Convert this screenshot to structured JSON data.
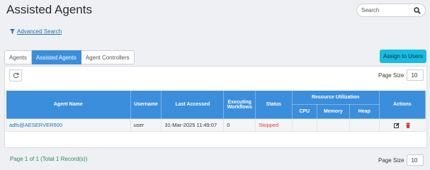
{
  "header": {
    "title": "Assisted Agents"
  },
  "search": {
    "placeholder": "Search",
    "value": ""
  },
  "advanced_search": {
    "label": "Advanced Search"
  },
  "tabs": [
    {
      "label": "Agents",
      "active": false
    },
    {
      "label": "Assisted Agents",
      "active": true
    },
    {
      "label": "Agent Controllers",
      "active": false
    }
  ],
  "toolbar": {
    "assign_label": "Assign to Users"
  },
  "page_size": {
    "label": "Page Size",
    "value": "10"
  },
  "table": {
    "columns": {
      "agent_name": "Agent Name",
      "username": "Username",
      "last_accessed": "Last Accessed",
      "executing_workflows": "Executing Workflows",
      "status": "Status",
      "resource_utilization": "Resource Utilization",
      "cpu": "CPU",
      "memory": "Memory",
      "heap": "Heap",
      "actions": "Actions"
    },
    "rows": [
      {
        "agent_name": "adfs@AESERVER500",
        "username": "user",
        "last_accessed": "31-Mar-2025 11:49:07",
        "executing_workflows": "0",
        "status": "Stopped",
        "cpu": "",
        "memory": "",
        "heap": ""
      }
    ]
  },
  "pager": {
    "info": "Page 1 of 1 (Total 1 Record(s))"
  },
  "colors": {
    "accent": "#3b8edb",
    "assign_button": "#16bde3",
    "status_stopped": "#e03b3b",
    "link": "#1c6fb5",
    "pager_text": "#2e8b57"
  },
  "icons": {
    "search": "search-icon",
    "filter": "filter-icon",
    "refresh": "refresh-icon",
    "edit": "edit-icon",
    "delete": "trash-icon"
  }
}
